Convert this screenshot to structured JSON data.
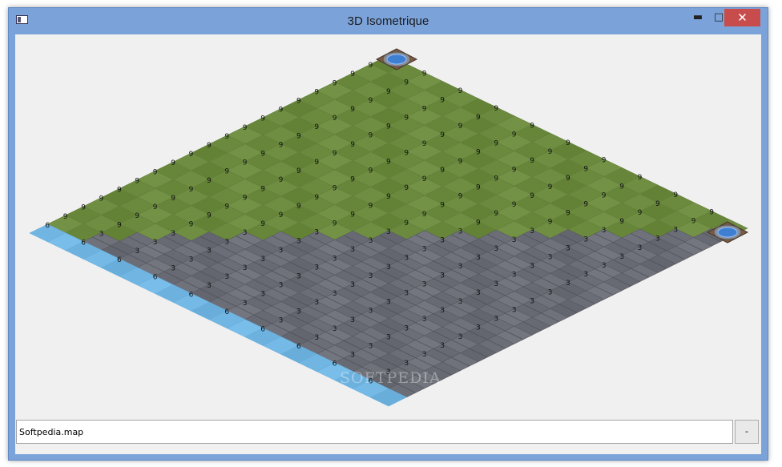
{
  "window": {
    "title": "3D Isometrique",
    "minimize_icon": "minimize-icon",
    "maximize_icon": "maximize-icon",
    "close_icon": "close-icon"
  },
  "map": {
    "columns": 20,
    "rows": 20,
    "tiles": {
      "grass": {
        "label": "9",
        "color": "#6b8a3e"
      },
      "stone": {
        "label": "3",
        "color": "#6c6e77"
      },
      "water": {
        "label": "6",
        "color": "#71b6e2"
      }
    },
    "watermark": "SOFTPEDIA",
    "wells": [
      "well-top",
      "well-right"
    ]
  },
  "footer": {
    "file_name": "Softpedia.map",
    "button_label": "-"
  }
}
